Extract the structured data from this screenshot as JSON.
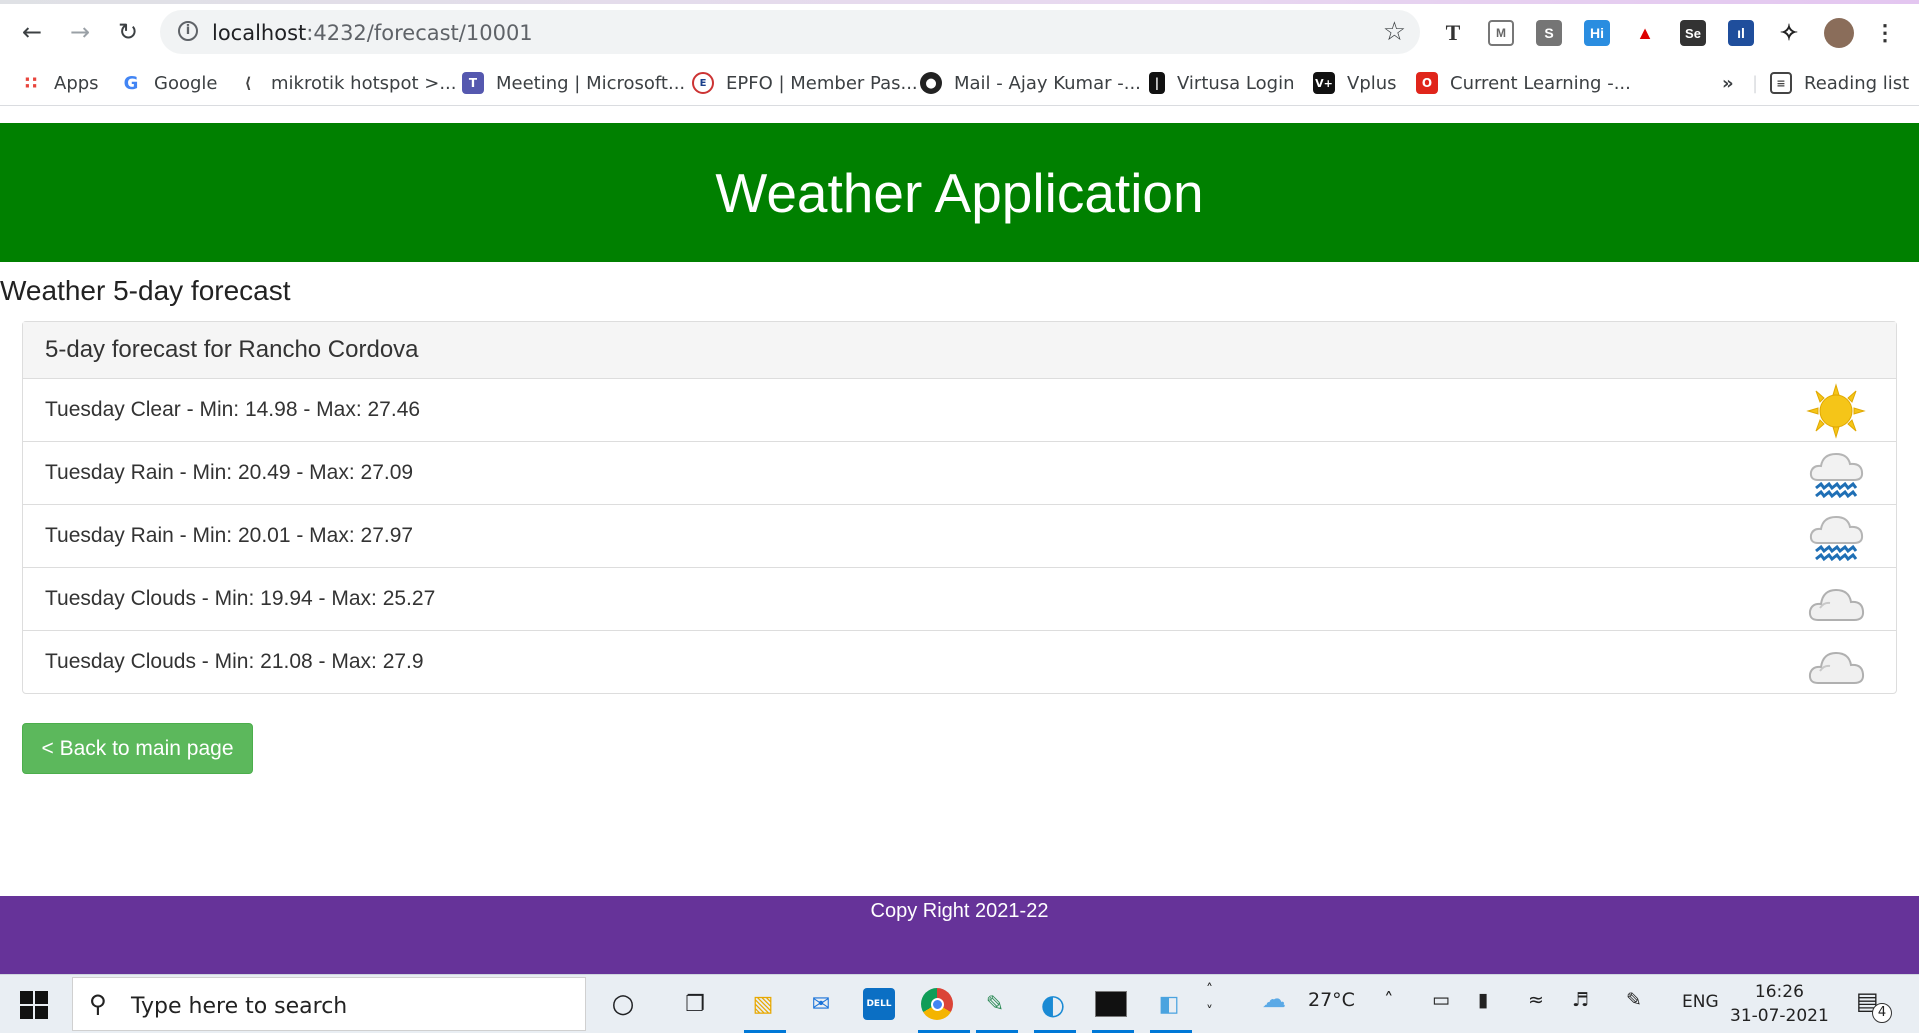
{
  "browser": {
    "url_host": "localhost",
    "url_path": ":4232/forecast/10001",
    "bookmarks": [
      {
        "label": "Apps",
        "icon": "apps-grid-icon"
      },
      {
        "label": "Google",
        "icon": "google-icon"
      },
      {
        "label": "mikrotik hotspot >...",
        "icon": "mikrotik-icon"
      },
      {
        "label": "Meeting | Microsoft...",
        "icon": "teams-icon"
      },
      {
        "label": "EPFO | Member Pas...",
        "icon": "epfo-icon"
      },
      {
        "label": "Mail - Ajay Kumar -...",
        "icon": "globe-icon"
      },
      {
        "label": "Virtusa Login",
        "icon": "virtusa-icon"
      },
      {
        "label": "Vplus",
        "icon": "vplus-icon"
      },
      {
        "label": "Current Learning -...",
        "icon": "oracle-icon"
      }
    ],
    "more_bookmarks": "»",
    "reading_list": "Reading list"
  },
  "page": {
    "header_title": "Weather Application",
    "subtitle": "Weather 5-day forecast",
    "panel_heading": "5-day forecast for Rancho Cordova",
    "forecast": [
      {
        "text": "Tuesday Clear - Min: 14.98 - Max: 27.46",
        "icon": "sun-icon"
      },
      {
        "text": "Tuesday Rain - Min: 20.49 - Max: 27.09",
        "icon": "rain-icon"
      },
      {
        "text": "Tuesday Rain - Min: 20.01 - Max: 27.97",
        "icon": "rain-icon"
      },
      {
        "text": "Tuesday Clouds - Min: 19.94 - Max: 25.27",
        "icon": "cloud-icon"
      },
      {
        "text": "Tuesday Clouds - Min: 21.08 - Max: 27.9",
        "icon": "cloud-icon"
      }
    ],
    "back_button": "< Back to main page",
    "footer": "Copy Right 2021-22"
  },
  "taskbar": {
    "search_placeholder": "Type here to search",
    "weather_temp": "27°C",
    "language": "ENG",
    "time": "16:26",
    "date": "31-07-2021",
    "notification_count": "4"
  },
  "colors": {
    "header_bg": "#008000",
    "footer_bg": "#663399",
    "button_bg": "#5cb85c"
  }
}
